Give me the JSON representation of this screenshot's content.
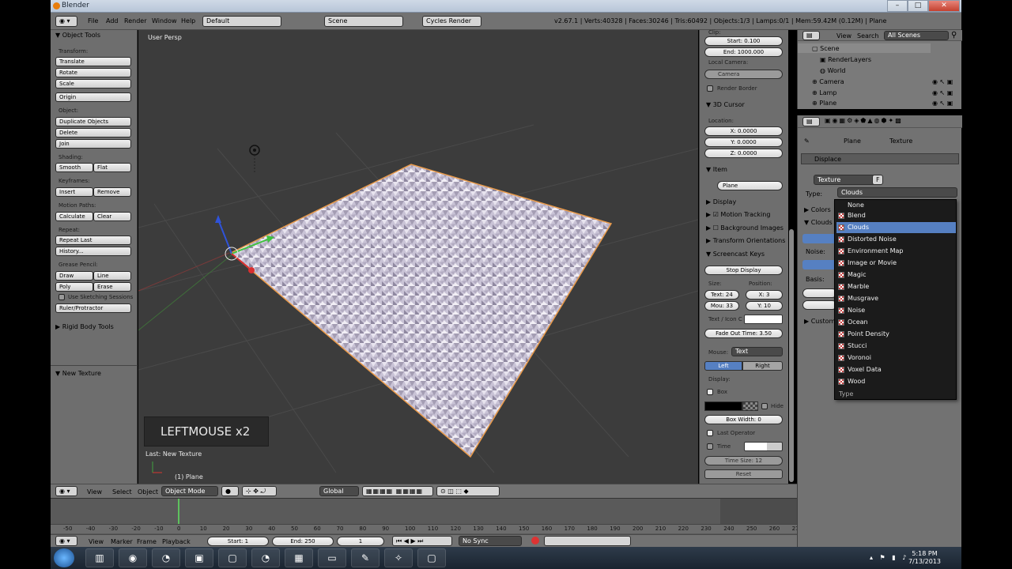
{
  "window": {
    "title": "Blender"
  },
  "infobar": {
    "menus": [
      "File",
      "Add",
      "Render",
      "Window",
      "Help"
    ],
    "layout": "Default",
    "scene": "Scene",
    "engine": "Cycles Render",
    "stats": "v2.67.1 | Verts:40328 | Faces:30246 | Tris:60492 | Objects:1/3 | Lamps:0/1 | Mem:59.42M (0.12M) | Plane"
  },
  "toolshelf": {
    "header": "Object Tools",
    "transform_label": "Transform:",
    "translate": "Translate",
    "rotate": "Rotate",
    "scale": "Scale",
    "origin": "Origin",
    "object_label": "Object:",
    "duplicate": "Duplicate Objects",
    "delete": "Delete",
    "join": "Join",
    "shading_label": "Shading:",
    "smooth": "Smooth",
    "flat": "Flat",
    "keyframes_label": "Keyframes:",
    "insert": "Insert",
    "remove": "Remove",
    "motion_label": "Motion Paths:",
    "calculate": "Calculate",
    "clear": "Clear",
    "repeat_label": "Repeat:",
    "repeat_last": "Repeat Last",
    "history": "History...",
    "grease_label": "Grease Pencil:",
    "draw": "Draw",
    "line": "Line",
    "poly": "Poly",
    "erase": "Erase",
    "sketching": "Use Sketching Sessions",
    "ruler": "Ruler/Protractor",
    "rigid": "Rigid Body Tools",
    "new_texture": "New Texture"
  },
  "viewport": {
    "label": "User Persp",
    "screencast": "LEFTMOUSE x2",
    "last_op": "Last: New Texture",
    "object": "(1) Plane"
  },
  "npanel": {
    "clip_label": "Clip:",
    "clip_start": "Start: 0.100",
    "clip_end": "End: 1000.000",
    "local_camera": "Local Camera:",
    "camera": "Camera",
    "render_border": "Render Border",
    "cursor_header": "3D Cursor",
    "location": "Location:",
    "cx": "X: 0.0000",
    "cy": "Y: 0.0000",
    "cz": "Z: 0.0000",
    "item_header": "Item",
    "item_name": "Plane",
    "display": "Display",
    "motion_tracking": "Motion Tracking",
    "background_images": "Background Images",
    "transform_orient": "Transform Orientations",
    "screencast_keys": "Screencast Keys",
    "stop_display": "Stop Display",
    "size": "Size:",
    "position": "Position:",
    "text_size": "Text: 24",
    "mouse_size": "Mou: 33",
    "pos_x": "X: 3",
    "pos_y": "Y: 10",
    "text_icon": "Text / Icon C",
    "fade": "Fade Out Time: 3.50",
    "mouse_label": "Mouse:",
    "mouse_val": "Text",
    "left": "Left",
    "right": "Right",
    "display2": "Display:",
    "box": "Box",
    "hide": "Hide",
    "box_width": "Box Width: 0",
    "last_operator": "Last Operator",
    "time": "Time",
    "time_size": "Time Size: 12",
    "reset": "Reset"
  },
  "outliner": {
    "view": "View",
    "search": "Search",
    "scenes": "All Scenes",
    "items": [
      "Scene",
      "RenderLayers",
      "World",
      "Camera",
      "Lamp",
      "Plane"
    ]
  },
  "properties": {
    "crumb_plane": "Plane",
    "crumb_texture": "Texture",
    "modifier": "Displace",
    "tex_name": "Texture",
    "tex_f": "F",
    "type_label": "Type:",
    "type_val": "Clouds",
    "colors": "Colors",
    "clouds": "Clouds",
    "noise": "Noise:",
    "basis": "Basis:",
    "custom": "Custom"
  },
  "dropdown": {
    "items": [
      "None",
      "Blend",
      "Clouds",
      "Distorted Noise",
      "Environment Map",
      "Image or Movie",
      "Magic",
      "Marble",
      "Musgrave",
      "Noise",
      "Ocean",
      "Point Density",
      "Stucci",
      "Voronoi",
      "Voxel Data",
      "Wood"
    ],
    "selected": "Clouds",
    "title": "Type"
  },
  "view_header": {
    "view": "View",
    "select": "Select",
    "object": "Object",
    "mode": "Object Mode",
    "orient": "Global"
  },
  "timeline": {
    "ticks": [
      "-50",
      "-40",
      "-30",
      "-20",
      "-10",
      "0",
      "10",
      "20",
      "30",
      "40",
      "50",
      "60",
      "70",
      "80",
      "90",
      "100",
      "110",
      "120",
      "130",
      "140",
      "150",
      "160",
      "170",
      "180",
      "190",
      "200",
      "210",
      "220",
      "230",
      "240",
      "250",
      "260",
      "270",
      "280"
    ],
    "view": "View",
    "marker": "Marker",
    "frame": "Frame",
    "playback": "Playback",
    "start": "Start: 1",
    "end": "End: 250",
    "current": "1",
    "sync": "No Sync"
  },
  "taskbar": {
    "time": "5:18 PM",
    "date": "7/13/2013"
  },
  "colors": {
    "accent": "#5680c2",
    "panel": "#727272",
    "viewport": "#3c3c3c"
  }
}
